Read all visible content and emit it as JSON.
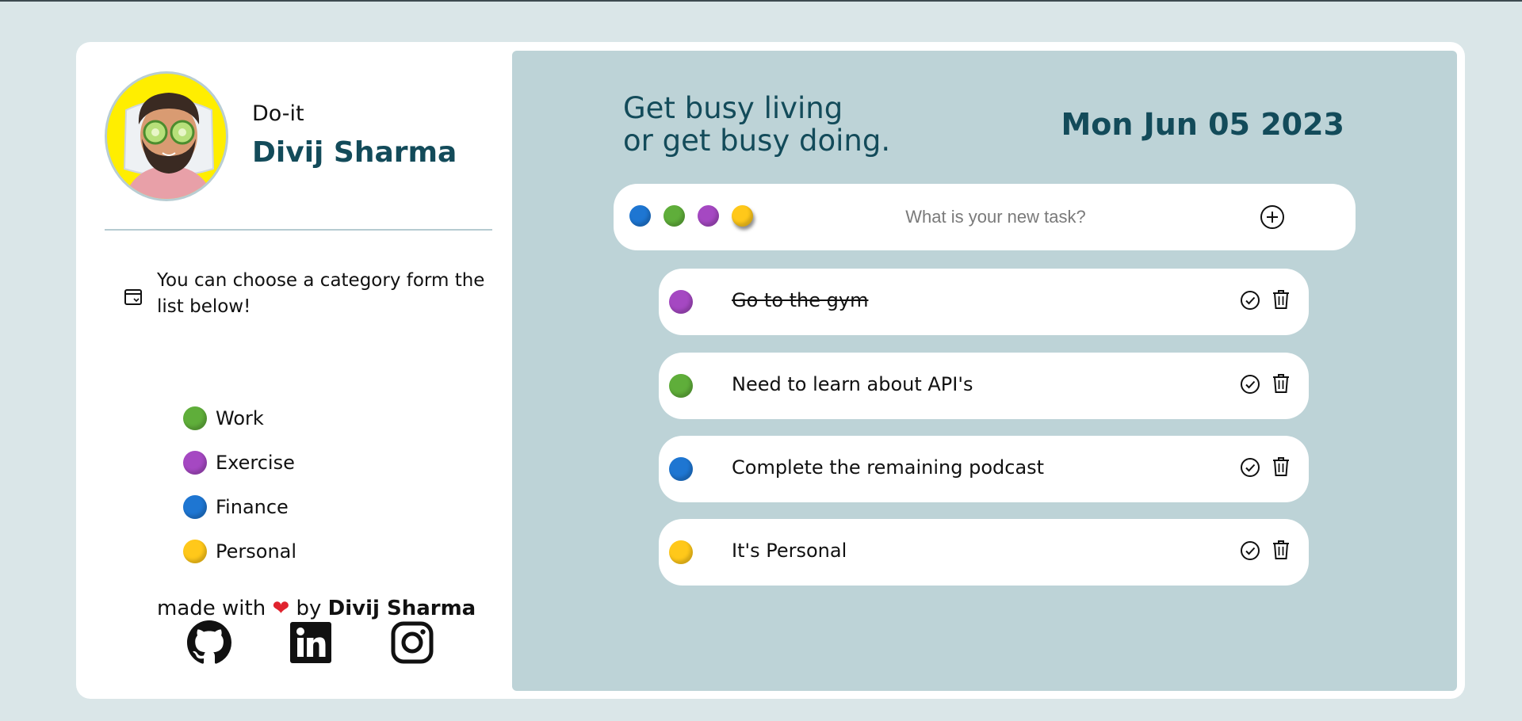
{
  "app": {
    "name": "Do-it",
    "user_name": "Divij Sharma"
  },
  "sidebar": {
    "hint": "You can choose a category form the list below!",
    "categories": [
      {
        "label": "Work",
        "color": "#5fae3a"
      },
      {
        "label": "Exercise",
        "color": "#a548c2"
      },
      {
        "label": "Finance",
        "color": "#1e76d2"
      },
      {
        "label": "Personal",
        "color": "#ffc81a"
      }
    ],
    "footer": {
      "prefix": "made with",
      "heart": "❤",
      "by": "by",
      "author": "Divij Sharma"
    },
    "social": [
      "github-icon",
      "linkedin-icon",
      "instagram-icon"
    ]
  },
  "main": {
    "quote_line1": "Get busy living",
    "quote_line2": "or get busy doing.",
    "date": "Mon Jun 05 2023",
    "new_task": {
      "placeholder": "What is your new task?",
      "category_colors": [
        "#1e76d2",
        "#5fae3a",
        "#a548c2",
        "#ffc81a"
      ],
      "selected_color": "#ffc81a"
    },
    "tasks": [
      {
        "text": "Go to the gym",
        "color": "#a548c2",
        "done": true
      },
      {
        "text": "Need to learn about API's",
        "color": "#5fae3a",
        "done": false
      },
      {
        "text": "Complete the remaining podcast",
        "color": "#1e76d2",
        "done": false
      },
      {
        "text": "It's Personal",
        "color": "#ffc81a",
        "done": false
      }
    ]
  },
  "colors": {
    "page_bg": "#dae6e8",
    "panel_bg": "#bdd3d7",
    "accent": "#134b5a"
  }
}
